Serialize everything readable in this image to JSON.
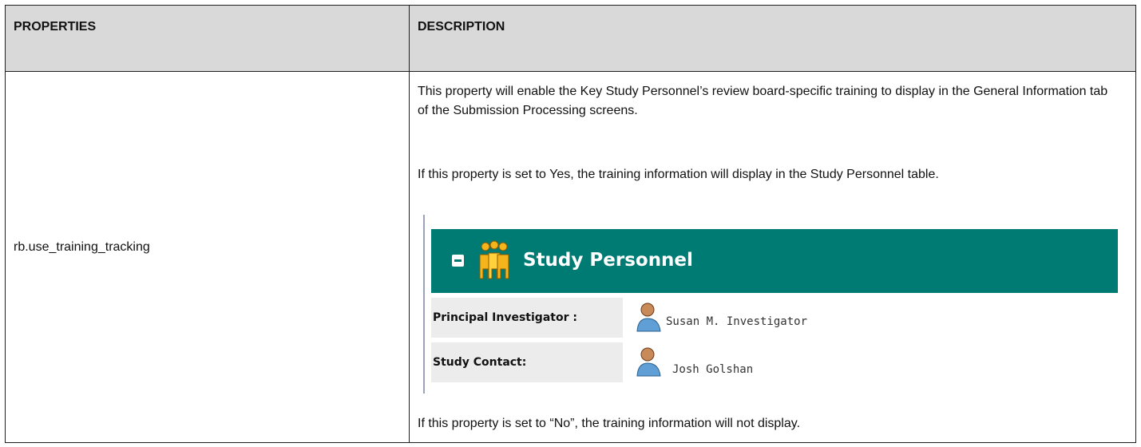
{
  "table": {
    "headers": {
      "properties": "PROPERTIES",
      "description": "DESCRIPTION"
    },
    "row": {
      "property": "rb.use_training_tracking",
      "paragraph1": "This property will enable the Key Study Personnel’s review board-specific training to display in the General Information tab of the Submission Processing screens.",
      "paragraph2": "If this property is set to Yes, the training information will display in the Study Personnel table.",
      "paragraph3": "If this property is set to “No”, the training information will not display."
    }
  },
  "screenshot": {
    "title": "Study Personnel",
    "rows": [
      {
        "label": "Principal Investigator :",
        "value": "Susan M. Investigator"
      },
      {
        "label": "Study Contact:",
        "value": "Josh Golshan"
      }
    ],
    "colors": {
      "header_bg": "#007b74",
      "label_bg": "#ececec",
      "table_header_bg": "#d9d9d9"
    },
    "icons": [
      "collapse-minus-icon",
      "people-group-icon",
      "person-icon"
    ]
  }
}
